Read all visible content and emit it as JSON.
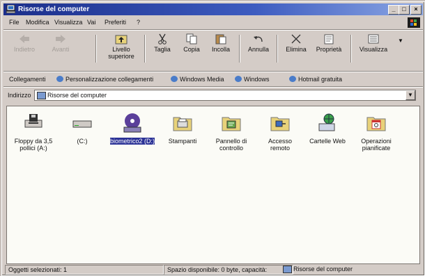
{
  "window": {
    "title": "Risorse del computer"
  },
  "controls": {
    "minimize": "_",
    "maximize": "□",
    "close": "×"
  },
  "menu": [
    "File",
    "Modifica",
    "Visualizza",
    "Vai",
    "Preferiti",
    "?"
  ],
  "toolbar": {
    "back": "Indietro",
    "forward": "Avanti",
    "up": "Livello superiore",
    "cut": "Taglia",
    "copy": "Copia",
    "paste": "Incolla",
    "undo": "Annulla",
    "delete": "Elimina",
    "properties": "Proprietà",
    "views": "Visualizza"
  },
  "links": {
    "label": "Collegamenti",
    "items": [
      "Personalizzazione collegamenti",
      "Windows Media",
      "Windows",
      "Hotmail gratuita"
    ]
  },
  "address": {
    "label": "Indirizzo",
    "value": "Risorse del computer"
  },
  "items": [
    {
      "label": "Floppy da 3,5 pollici (A:)",
      "icon": "floppy-drive-icon",
      "selected": false
    },
    {
      "label": "(C:)",
      "icon": "hard-drive-icon",
      "selected": false
    },
    {
      "label": "biometrico2 (D:)",
      "icon": "cd-drive-icon",
      "selected": true
    },
    {
      "label": "Stampanti",
      "icon": "printers-folder-icon",
      "selected": false
    },
    {
      "label": "Pannello di controllo",
      "icon": "control-panel-icon",
      "selected": false
    },
    {
      "label": "Accesso remoto",
      "icon": "dialup-networking-icon",
      "selected": false
    },
    {
      "label": "Cartelle Web",
      "icon": "web-folders-icon",
      "selected": false
    },
    {
      "label": "Operazioni pianificate",
      "icon": "scheduled-tasks-icon",
      "selected": false
    }
  ],
  "status": {
    "selected": "Oggetti selezionati: 1",
    "space": "Spazio disponibile: 0 byte, capacità:",
    "location": "Risorse del computer"
  },
  "colors": {
    "titlebar": "#1b2e8a",
    "selection": "#2b3296",
    "face": "#d4ccc7"
  }
}
